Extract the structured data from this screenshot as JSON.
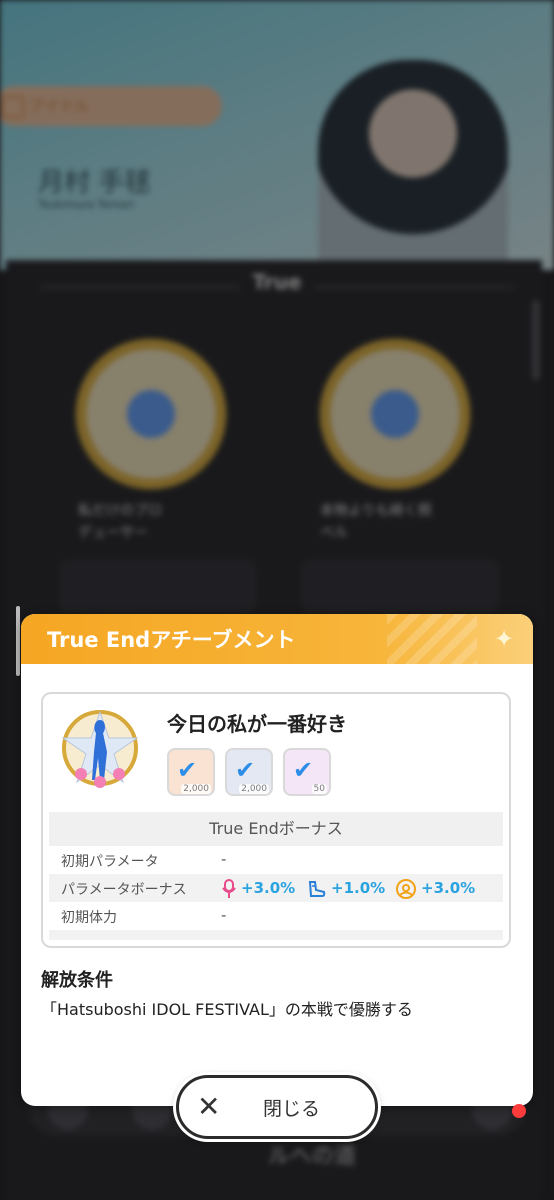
{
  "background": {
    "tab_label": "アイドル",
    "idol_name": "月村 手毬",
    "idol_name_romaji": "Tsukimura Temari",
    "section_title": "True",
    "achievements": [
      {
        "caption_line1": "私だけのプロ",
        "caption_line2": "デューサー"
      },
      {
        "caption_line1": "本物よりも綺く照",
        "caption_line2": "ベル"
      }
    ],
    "nav_label": "ルへの道"
  },
  "modal": {
    "title": "True Endアチーブメント",
    "achievement_name": "今日の私が一番好き",
    "rewards": [
      {
        "icon": "ticket-check-icon",
        "amount": "2,000",
        "color": "#fbe3d3"
      },
      {
        "icon": "ticket-check-icon",
        "amount": "2,000",
        "color": "#e3e8f2"
      },
      {
        "icon": "ticket-check-icon",
        "amount": "50",
        "color": "#f4e6f6"
      }
    ],
    "bonus_header": "True Endボーナス",
    "rows": {
      "initial_params": {
        "label": "初期パラメータ",
        "value": "-"
      },
      "param_bonus": {
        "label": "パラメータボーナス"
      },
      "initial_stamina": {
        "label": "初期体力",
        "value": "-"
      }
    },
    "bonuses": [
      {
        "icon": "microphone-icon",
        "value": "+3.0%",
        "color": "#e94b8a"
      },
      {
        "icon": "dance-shoe-icon",
        "value": "+1.0%",
        "color": "#2a7fd6"
      },
      {
        "icon": "visual-star-icon",
        "value": "+3.0%",
        "color": "#f2a317"
      }
    ],
    "condition_title": "解放条件",
    "condition_text": "「Hatsuboshi IDOL FESTIVAL」の本戦で優勝する"
  },
  "close_button": {
    "label": "閉じる"
  },
  "colors": {
    "accent": "#f5a623",
    "bonus_text": "#2aa3e0",
    "check": "#2d8ee8"
  }
}
